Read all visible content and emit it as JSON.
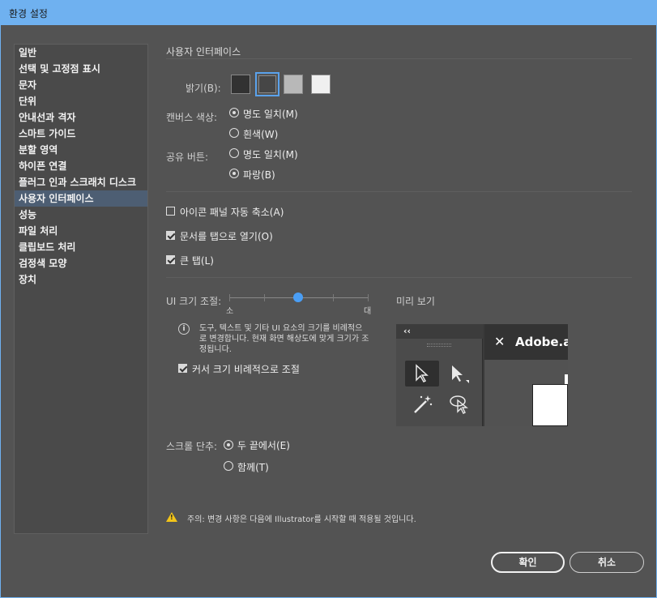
{
  "window": {
    "title": "환경 설정"
  },
  "sidebar": {
    "items": [
      {
        "label": "일반"
      },
      {
        "label": "선택 및 고정점 표시"
      },
      {
        "label": "문자"
      },
      {
        "label": "단위"
      },
      {
        "label": "안내선과 격자"
      },
      {
        "label": "스마트 가이드"
      },
      {
        "label": "분할 영역"
      },
      {
        "label": "하이픈 연결"
      },
      {
        "label": "플러그 인과 스크래치 디스크"
      },
      {
        "label": "사용자 인터페이스",
        "selected": true
      },
      {
        "label": "성능"
      },
      {
        "label": "파일 처리"
      },
      {
        "label": "클립보드 처리"
      },
      {
        "label": "검정색 모양"
      },
      {
        "label": "장치"
      }
    ]
  },
  "main": {
    "section_title": "사용자 인터페이스",
    "brightness": {
      "label": "밝기(B):",
      "swatches": [
        {
          "color": "#323232"
        },
        {
          "color": "#464646",
          "selected": true
        },
        {
          "color": "#b8b8b8"
        },
        {
          "color": "#f0f0f0"
        }
      ]
    },
    "canvas_color": {
      "label": "캔버스 색상:",
      "options": [
        {
          "label": "명도 일치(M)",
          "checked": true
        },
        {
          "label": "흰색(W)",
          "checked": false
        }
      ]
    },
    "share_button": {
      "label": "공유 버튼:",
      "options": [
        {
          "label": "명도 일치(M)",
          "checked": false
        },
        {
          "label": "파랑(B)",
          "checked": true
        }
      ]
    },
    "checkboxes": [
      {
        "label": "아이콘 패널 자동 축소(A)",
        "checked": false
      },
      {
        "label": "문서를 탭으로 열기(O)",
        "checked": true
      },
      {
        "label": "큰 탭(L)",
        "checked": true
      }
    ],
    "ui_scale": {
      "label": "UI 크기 조절:",
      "min_label": "소",
      "max_label": "대",
      "value_fraction": 0.5,
      "info": "도구, 텍스트 및 기타 UI 요소의 크기를 비례적으로 변경합니다. 현재 화면 해상도에 맞게 크기가 조정됩니다.",
      "cursor_checkbox": {
        "label": "커서 크기 비례적으로 조절",
        "checked": true
      }
    },
    "preview": {
      "label": "미리 보기",
      "collapse_glyph": "‹‹",
      "doc_close": "✕",
      "doc_name": "Adobe.ai"
    },
    "scroll_wheel": {
      "label": "스크롤 단추:",
      "options": [
        {
          "label": "두 끝에서(E)",
          "checked": true
        },
        {
          "label": "함께(T)",
          "checked": false
        }
      ]
    },
    "warning": {
      "text": "주의:  변경 사항은 다음에 Illustrator를 시작할 때 적용될 것입니다."
    }
  },
  "footer": {
    "ok_label": "확인",
    "cancel_label": "취소"
  },
  "colors": {
    "title_bar": "#6fb1f0",
    "background": "#535353",
    "selected_item": "#4d5e73",
    "slider_accent": "#4a9ef5",
    "warning_icon": "#f2c419"
  }
}
